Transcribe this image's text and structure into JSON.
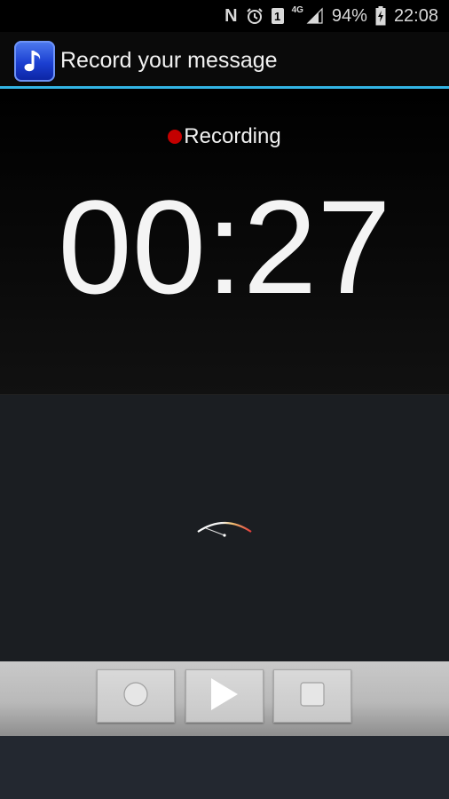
{
  "status_bar": {
    "n_label": "N",
    "sim_label": "1",
    "network_label": "4G",
    "battery_percent": "94%",
    "time": "22:08",
    "icons": [
      "nfc-icon",
      "alarm-icon",
      "sim-icon",
      "signal-icon",
      "battery-charging-icon"
    ]
  },
  "action_bar": {
    "title": "Record your message",
    "app_icon": "music-note-icon",
    "accent": "#33b5e5"
  },
  "recorder": {
    "status": "Recording",
    "status_color": "#c40000",
    "elapsed": "00:27"
  },
  "level_meter": {
    "icon": "level-meter-icon"
  },
  "controls": {
    "buttons": [
      {
        "name": "record",
        "icon": "record-circle-icon"
      },
      {
        "name": "play",
        "icon": "play-icon"
      },
      {
        "name": "stop",
        "icon": "stop-square-icon"
      }
    ]
  }
}
